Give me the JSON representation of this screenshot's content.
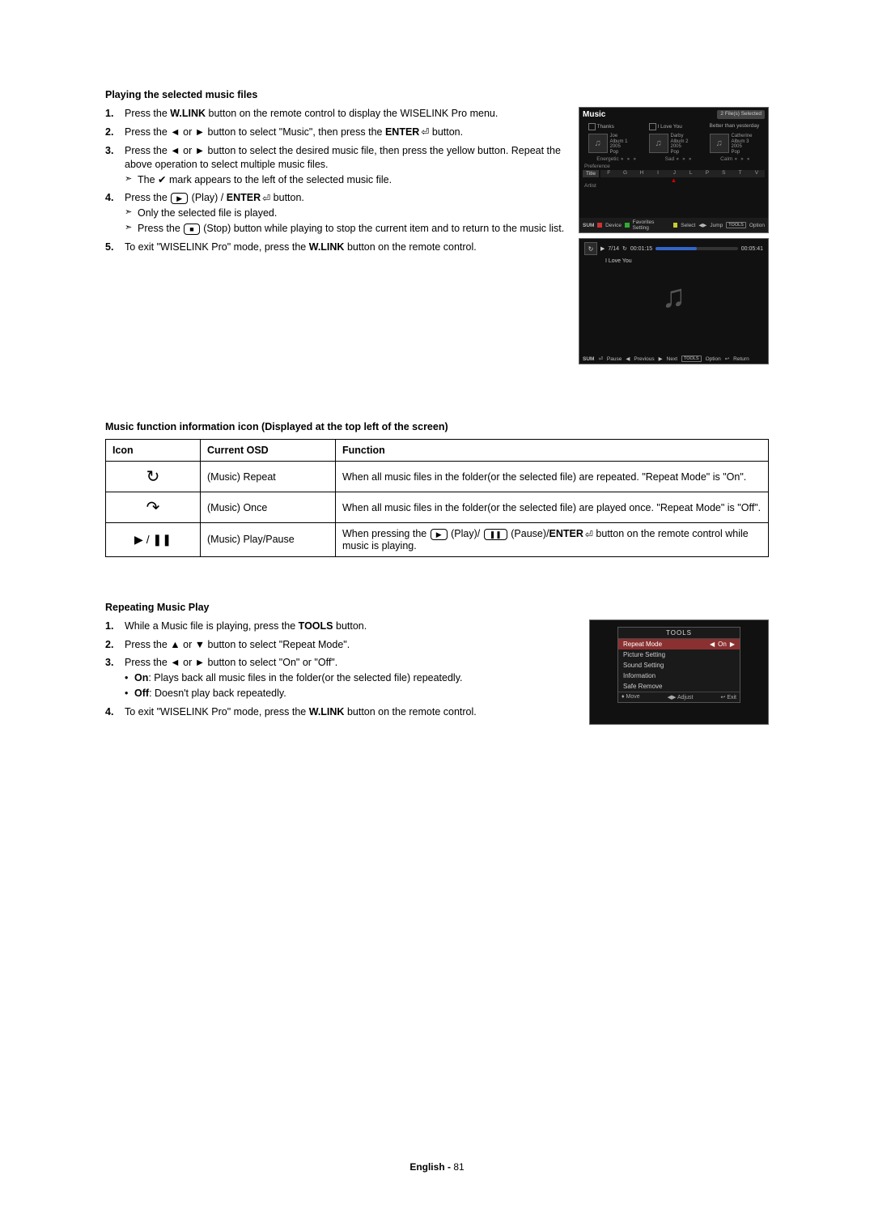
{
  "section1": {
    "title": "Playing the selected music files",
    "steps": [
      {
        "num": "1.",
        "text_pre": "Press the ",
        "bold": "W.LINK",
        "text_post": " button on the remote control to display the WISELINK Pro menu."
      },
      {
        "num": "2.",
        "text_pre": "Press the ◄ or ► button to select \"Music\", then press the ",
        "bold": "ENTER",
        "enter_icon": true,
        "text_post": " button."
      },
      {
        "num": "3.",
        "text": "Press the ◄ or ► button to select the desired music file, then press the yellow button. Repeat the above operation to select multiple music files.",
        "subs": [
          {
            "text": "The ✔ mark appears to the left of the selected music file."
          }
        ]
      },
      {
        "num": "4.",
        "text_pre": "Press the ",
        "play_btn": true,
        "mid": " (Play) / ",
        "bold": "ENTER",
        "enter_icon": true,
        "text_post": " button.",
        "subs": [
          {
            "text": "Only the selected file is played."
          },
          {
            "text_pre": "Press the ",
            "stop_btn": true,
            "text_post": " (Stop) button while playing to stop the current item and to return to the music list."
          }
        ]
      },
      {
        "num": "5.",
        "text_pre": "To exit \"WISELINK Pro\" mode, press the ",
        "bold": "W.LINK",
        "text_post": " button on the remote control."
      }
    ]
  },
  "shot_music": {
    "title": "Music",
    "badge": "2 File(s) Selected",
    "cards": [
      {
        "group": "Thanks",
        "artist": "Joe",
        "album": "Album 1",
        "year": "2005",
        "genre": "Pop",
        "mood": "Energetic"
      },
      {
        "group": "I Love You",
        "artist": "Darby",
        "album": "Album 2",
        "year": "2005",
        "genre": "Pop",
        "mood": "Sad"
      },
      {
        "group": "Better than yesterday",
        "artist": "Catherine",
        "album": "Album 3",
        "year": "2005",
        "genre": "Pop",
        "mood": "Calm"
      }
    ],
    "preference": "Preference",
    "alpha_label": "Title",
    "letters": [
      "F",
      "G",
      "H",
      "I",
      "J",
      "L",
      "P",
      "S",
      "T",
      "V"
    ],
    "artist": "Artist",
    "footer": {
      "sum": "SUM",
      "device": "Device",
      "fav": "Favorites Setting",
      "select": "Select",
      "jump": "Jump",
      "tools": "TOOLS",
      "option": "Option"
    }
  },
  "shot_play": {
    "index": "7/14",
    "elapsed": "00:01:15",
    "total": "00:05:41",
    "song": "I Love You",
    "footer": {
      "sum": "SUM",
      "pause": "Pause",
      "prev": "Previous",
      "next": "Next",
      "tools": "TOOLS",
      "option": "Option",
      "ret": "Return"
    }
  },
  "info_title": "Music function information icon (Displayed at the top left of the screen)",
  "table": {
    "headers": {
      "icon": "Icon",
      "osd": "Current OSD",
      "func": "Function"
    },
    "rows": [
      {
        "icon": "↻",
        "osd": "(Music) Repeat",
        "func": "When all music files in the folder(or the selected file) are repeated. \"Repeat Mode\" is \"On\"."
      },
      {
        "icon": "↷",
        "osd": "(Music) Once",
        "func": "When all music files in the folder(or the selected file) are played once. \"Repeat Mode\" is \"Off\"."
      },
      {
        "icon": "▶ / ❚❚",
        "osd": "(Music) Play/Pause",
        "func_pre": "When pressing the ",
        "func_mid": " (Play)/ ",
        "func_mid2": " (Pause)/",
        "func_bold": "ENTER",
        "func_post": " button on the remote control while music is playing."
      }
    ]
  },
  "section3": {
    "title": "Repeating Music Play",
    "steps": [
      {
        "num": "1.",
        "text_pre": "While a Music file is playing, press the ",
        "bold": "TOOLS",
        "text_post": " button."
      },
      {
        "num": "2.",
        "text": "Press the ▲ or ▼ button to select \"Repeat Mode\"."
      },
      {
        "num": "3.",
        "text": "Press the ◄ or ► button to select \"On\" or \"Off\".",
        "bullets": [
          {
            "bold": "On",
            "rest": ": Plays back all music files in the folder(or the selected file) repeatedly."
          },
          {
            "bold": "Off",
            "rest": ": Doesn't play back repeatedly."
          }
        ]
      },
      {
        "num": "4.",
        "text_pre": "To exit \"WISELINK Pro\" mode, press the ",
        "bold": "W.LINK",
        "text_post": " button on the remote control."
      }
    ]
  },
  "shot_tools": {
    "header": "TOOLS",
    "rows": [
      {
        "label": "Repeat Mode",
        "val": "On",
        "sel": true
      },
      {
        "label": "Picture Setting"
      },
      {
        "label": "Sound Setting"
      },
      {
        "label": "Information"
      },
      {
        "label": "Safe Remove"
      }
    ],
    "footer": {
      "move": "Move",
      "adjust": "Adjust",
      "exit": "Exit"
    }
  },
  "page_footer": {
    "lang": "English - ",
    "page": "81"
  }
}
